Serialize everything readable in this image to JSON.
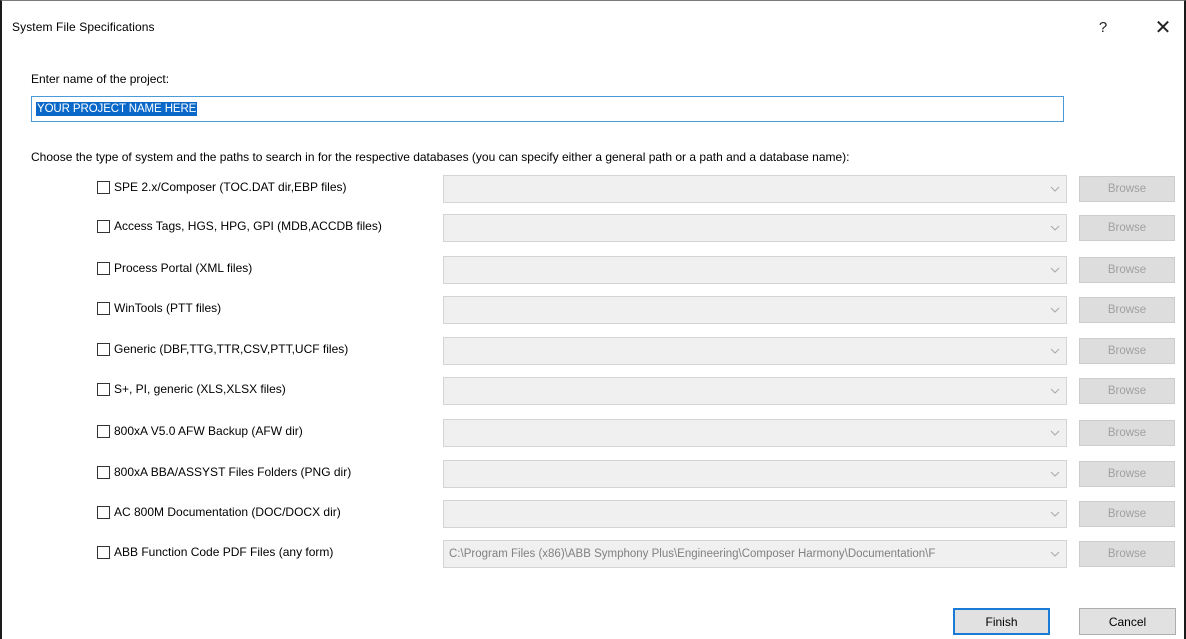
{
  "window": {
    "title": "System File Specifications",
    "help_glyph": "?",
    "close_glyph": "✕"
  },
  "project": {
    "label": "Enter name of the project:",
    "value": "YOUR PROJECT NAME HERE"
  },
  "instruction": "Choose the type of system and the paths to search in for the respective databases (you can specify either a general path or a path and a database name):",
  "systems": [
    {
      "label": "SPE 2.x/Composer (TOC.DAT dir,EBP files)",
      "checked": false,
      "path": "",
      "enabled": false,
      "browse_label": "Browse"
    },
    {
      "label": "Access Tags, HGS, HPG, GPI  (MDB,ACCDB files)",
      "checked": false,
      "path": "",
      "enabled": false,
      "browse_label": "Browse"
    },
    {
      "label": "Process Portal (XML files)",
      "checked": false,
      "path": "",
      "enabled": false,
      "browse_label": "Browse"
    },
    {
      "label": "WinTools (PTT files)",
      "checked": false,
      "path": "",
      "enabled": false,
      "browse_label": "Browse"
    },
    {
      "label": "Generic (DBF,TTG,TTR,CSV,PTT,UCF files)",
      "checked": false,
      "path": "",
      "enabled": false,
      "browse_label": "Browse"
    },
    {
      "label": "S+, PI, generic (XLS,XLSX files)",
      "checked": false,
      "path": "",
      "enabled": false,
      "browse_label": "Browse"
    },
    {
      "label": "800xA V5.0 AFW Backup (AFW dir)",
      "checked": false,
      "path": "",
      "enabled": false,
      "browse_label": "Browse"
    },
    {
      "label": "800xA BBA/ASSYST Files Folders (PNG dir)",
      "checked": false,
      "path": "",
      "enabled": false,
      "browse_label": "Browse"
    },
    {
      "label": "AC 800M Documentation (DOC/DOCX dir)",
      "checked": false,
      "path": "",
      "enabled": false,
      "browse_label": "Browse"
    },
    {
      "label": "ABB Function Code PDF Files (any form)",
      "checked": false,
      "path": "C:\\Program Files (x86)\\ABB Symphony Plus\\Engineering\\Composer Harmony\\Documentation\\F",
      "enabled": false,
      "browse_label": "Browse"
    }
  ],
  "buttons": {
    "finish": "Finish",
    "cancel": "Cancel"
  },
  "colors": {
    "selection": "#0a68c8",
    "focus_border": "#1a7ad6",
    "disabled_text": "#a0a0a0"
  }
}
